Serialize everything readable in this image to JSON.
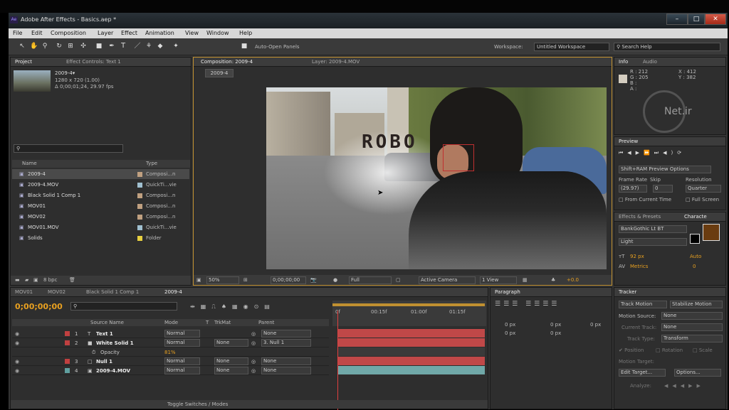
{
  "window": {
    "title": "Adobe After Effects - Basics.aep *",
    "ae_logo": "Ae",
    "min": "–",
    "max": "□",
    "close": "✕"
  },
  "menu": [
    "File",
    "Edit",
    "Composition",
    "Layer",
    "Effect",
    "Animation",
    "View",
    "Window",
    "Help"
  ],
  "toolbar": {
    "auto_open": "Auto-Open Panels",
    "workspace_label": "Workspace:",
    "workspace_value": "Untitled Workspace",
    "search_help": "Search Help"
  },
  "project": {
    "tab": "Project",
    "tab2": "Effect Controls: Text 1",
    "comp_name": "2009-4▾",
    "comp_res": "1280 x 720 (1.00)",
    "comp_dur": "Δ 0;00;01;24, 29.97 fps",
    "col_name": "Name",
    "col_type": "Type",
    "bpc": "8 bpc",
    "items": [
      {
        "name": "2009-4",
        "type": "Composi...n",
        "color": "#c0a080"
      },
      {
        "name": "2009-4.MOV",
        "type": "QuickTi...vie",
        "color": "#a0c0d0"
      },
      {
        "name": "Black Solid 1 Comp 1",
        "type": "Composi...n",
        "color": "#c0a080"
      },
      {
        "name": "MOV01",
        "type": "Composi...n",
        "color": "#c0a080"
      },
      {
        "name": "MOV02",
        "type": "Composi...n",
        "color": "#c0a080"
      },
      {
        "name": "MOV01.MOV",
        "type": "QuickTi...vie",
        "color": "#a0c0d0"
      },
      {
        "name": "Solids",
        "type": "Folder",
        "color": "#e8d040"
      }
    ]
  },
  "comp": {
    "tab": "Composition: 2009-4",
    "tab_layer": "Layer: 2009-4.MOV",
    "chip": "2009-4",
    "title_text": "ROBO",
    "zoom": "50%",
    "timecode": "0;00;00;00",
    "quality": "Full",
    "camera": "Active Camera",
    "view": "1 View",
    "exposure": "+0.0"
  },
  "info": {
    "tab": "Info",
    "tab2": "Audio",
    "r": "R : 212",
    "g": "G : 205",
    "b": "B :",
    "a": "A :",
    "x": "X : 412",
    "y": "Y : 382",
    "watermark": "Net.ir"
  },
  "preview": {
    "tab": "Preview",
    "mode": "Shift+RAM Preview Options",
    "frame_rate_label": "Frame Rate",
    "skip_label": "Skip",
    "resolution_label": "Resolution",
    "frame_rate": "(29.97)",
    "skip": "0",
    "resolution": "Quarter",
    "from_current": "From Current Time",
    "full_screen": "Full Screen"
  },
  "character": {
    "tab": "Effects & Presets",
    "tab2": "Characte",
    "font": "BankGothic Lt BT",
    "style": "Light",
    "size": "92 px",
    "leading": "Auto",
    "tracking_label": "Metrics",
    "tracking": "0"
  },
  "timeline": {
    "tabs": [
      "MOV01",
      "MOV02",
      "Black Solid 1 Comp 1",
      "2009-4"
    ],
    "timecode": "0;00;00;00",
    "ruler": [
      "0f",
      "00:15f",
      "01:00f",
      "01:15f"
    ],
    "col_source": "Source Name",
    "col_mode": "Mode",
    "col_t": "T",
    "col_trkmat": "TrkMat",
    "col_parent": "Parent",
    "layers": [
      {
        "num": "1",
        "name": "Text 1",
        "icon": "T",
        "mode": "Normal",
        "trk": "",
        "parent": "None",
        "color": "#c04040",
        "bar": "#c04848"
      },
      {
        "num": "2",
        "name": "White Solid 1",
        "icon": "■",
        "mode": "Normal",
        "trk": "None",
        "parent": "3. Null 1",
        "color": "#c04040",
        "bar": "#c04848"
      },
      {
        "num": "",
        "name": "Opacity",
        "icon": "",
        "mode": "",
        "trk": "",
        "parent": "",
        "value": "81%",
        "color": "",
        "bar": ""
      },
      {
        "num": "3",
        "name": "Null 1",
        "icon": "□",
        "mode": "Normal",
        "trk": "None",
        "parent": "None",
        "color": "#c04040",
        "bar": "#c04848"
      },
      {
        "num": "4",
        "name": "2009-4.MOV",
        "icon": "▣",
        "mode": "Normal",
        "trk": "None",
        "parent": "None",
        "color": "#60a0a0",
        "bar": "#70a8a8"
      }
    ],
    "toggle": "Toggle Switches / Modes"
  },
  "paragraph": {
    "tab": "Paragraph",
    "px": "0 px"
  },
  "tracker": {
    "tab": "Tracker",
    "track_motion": "Track Motion",
    "stabilize": "Stabilize Motion",
    "motion_source_label": "Motion Source:",
    "motion_source": "None",
    "current_track": "Current Track:",
    "current_track_val": "None",
    "track_type": "Track Type:",
    "track_type_val": "Transform",
    "position": "Position",
    "rotation": "Rotation",
    "scale": "Scale",
    "motion_target": "Motion Target:",
    "edit_target": "Edit Target...",
    "options": "Options...",
    "analyze": "Analyze:"
  }
}
